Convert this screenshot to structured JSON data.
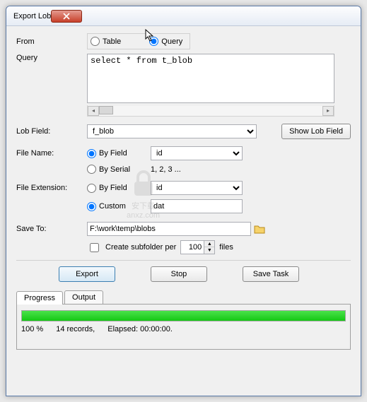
{
  "window": {
    "title": "Export Lob"
  },
  "labels": {
    "from": "From",
    "query": "Query",
    "lobField": "Lob Field:",
    "fileName": "File Name:",
    "fileExtension": "File Extension:",
    "saveTo": "Save To:"
  },
  "source": {
    "table": "Table",
    "query": "Query",
    "selected": "query"
  },
  "queryText": "select * from t_blob",
  "lobField": {
    "value": "f_blob",
    "showBtn": "Show Lob Field"
  },
  "fileName": {
    "byField": "By Field",
    "bySerial": "By Serial",
    "fieldValue": "id",
    "serialHint": "1, 2, 3 ..."
  },
  "fileExt": {
    "byField": "By Field",
    "custom": "Custom",
    "fieldValue": "id",
    "customValue": "dat"
  },
  "saveTo": {
    "path": "F:\\work\\temp\\blobs",
    "subfolder": "Create subfolder per",
    "count": "100",
    "files": "files"
  },
  "buttons": {
    "export": "Export",
    "stop": "Stop",
    "saveTask": "Save Task"
  },
  "tabs": {
    "progress": "Progress",
    "output": "Output"
  },
  "status": {
    "pct": "100 %",
    "records": "14 records,",
    "elapsed": "Elapsed: 00:00:00."
  },
  "watermark": {
    "line1": "安下载",
    "line2": "anxz.com"
  }
}
